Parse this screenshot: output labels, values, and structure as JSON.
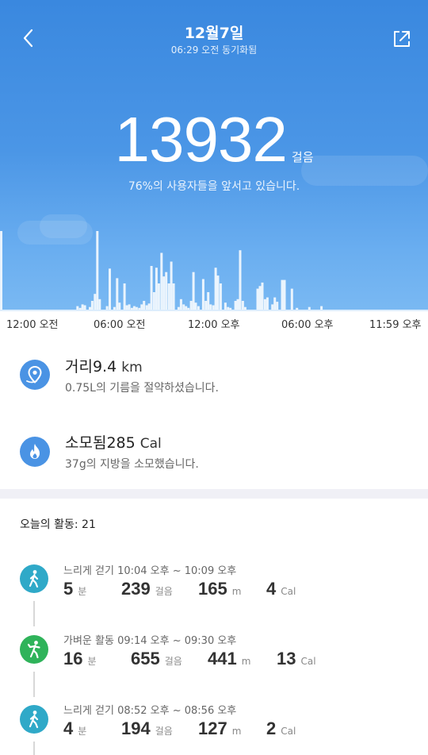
{
  "header": {
    "date": "12월7일",
    "sync_status": "06:29 오전 동기화됨",
    "back_icon": "chevron-left-icon",
    "share_icon": "share-icon"
  },
  "steps": {
    "count": "13932",
    "unit": "걸음",
    "percentile_text": "76%의 사용자들을 앞서고 있습니다."
  },
  "chart_data": {
    "type": "bar",
    "title": "",
    "x_tick_labels": [
      "12:00 오전",
      "06:00 오전",
      "12:00 오후",
      "06:00 오후",
      "11:59 오후"
    ],
    "x_range_minutes": [
      0,
      1439
    ],
    "y_max": 1,
    "bars": [
      {
        "t": 0,
        "v": 0.9
      },
      {
        "t": 258,
        "v": 0.04
      },
      {
        "t": 267,
        "v": 0.02
      },
      {
        "t": 275,
        "v": 0.06
      },
      {
        "t": 283,
        "v": 0.05
      },
      {
        "t": 300,
        "v": 0.03
      },
      {
        "t": 308,
        "v": 0.1
      },
      {
        "t": 317,
        "v": 0.18
      },
      {
        "t": 325,
        "v": 0.9
      },
      {
        "t": 333,
        "v": 0.12
      },
      {
        "t": 358,
        "v": 0.04
      },
      {
        "t": 367,
        "v": 0.47
      },
      {
        "t": 383,
        "v": 0.03
      },
      {
        "t": 392,
        "v": 0.36
      },
      {
        "t": 400,
        "v": 0.08
      },
      {
        "t": 417,
        "v": 0.3
      },
      {
        "t": 425,
        "v": 0.05
      },
      {
        "t": 433,
        "v": 0.06
      },
      {
        "t": 442,
        "v": 0.02
      },
      {
        "t": 450,
        "v": 0.04
      },
      {
        "t": 458,
        "v": 0.03
      },
      {
        "t": 467,
        "v": 0.02
      },
      {
        "t": 475,
        "v": 0.06
      },
      {
        "t": 483,
        "v": 0.1
      },
      {
        "t": 492,
        "v": 0.05
      },
      {
        "t": 500,
        "v": 0.07
      },
      {
        "t": 508,
        "v": 0.5
      },
      {
        "t": 517,
        "v": 0.2
      },
      {
        "t": 525,
        "v": 0.48
      },
      {
        "t": 533,
        "v": 0.3
      },
      {
        "t": 542,
        "v": 0.65
      },
      {
        "t": 550,
        "v": 0.38
      },
      {
        "t": 558,
        "v": 0.43
      },
      {
        "t": 567,
        "v": 0.3
      },
      {
        "t": 575,
        "v": 0.55
      },
      {
        "t": 583,
        "v": 0.3
      },
      {
        "t": 600,
        "v": 0.03
      },
      {
        "t": 608,
        "v": 0.12
      },
      {
        "t": 617,
        "v": 0.06
      },
      {
        "t": 625,
        "v": 0.04
      },
      {
        "t": 633,
        "v": 0.02
      },
      {
        "t": 642,
        "v": 0.1
      },
      {
        "t": 650,
        "v": 0.43
      },
      {
        "t": 658,
        "v": 0.08
      },
      {
        "t": 667,
        "v": 0.04
      },
      {
        "t": 683,
        "v": 0.35
      },
      {
        "t": 692,
        "v": 0.1
      },
      {
        "t": 700,
        "v": 0.2
      },
      {
        "t": 708,
        "v": 0.06
      },
      {
        "t": 717,
        "v": 0.05
      },
      {
        "t": 725,
        "v": 0.48
      },
      {
        "t": 733,
        "v": 0.39
      },
      {
        "t": 742,
        "v": 0.3
      },
      {
        "t": 758,
        "v": 0.08
      },
      {
        "t": 767,
        "v": 0.03
      },
      {
        "t": 775,
        "v": 0.02
      },
      {
        "t": 792,
        "v": 0.1
      },
      {
        "t": 800,
        "v": 0.12
      },
      {
        "t": 808,
        "v": 0.68
      },
      {
        "t": 817,
        "v": 0.1
      },
      {
        "t": 825,
        "v": 0.03
      },
      {
        "t": 867,
        "v": 0.24
      },
      {
        "t": 875,
        "v": 0.27
      },
      {
        "t": 883,
        "v": 0.31
      },
      {
        "t": 892,
        "v": 0.12
      },
      {
        "t": 900,
        "v": 0.14
      },
      {
        "t": 917,
        "v": 0.06
      },
      {
        "t": 925,
        "v": 0.14
      },
      {
        "t": 933,
        "v": 0.09
      },
      {
        "t": 950,
        "v": 0.34
      },
      {
        "t": 958,
        "v": 0.34
      },
      {
        "t": 983,
        "v": 0.24
      },
      {
        "t": 1000,
        "v": 0.02
      },
      {
        "t": 1042,
        "v": 0.03
      },
      {
        "t": 1083,
        "v": 0.04
      }
    ]
  },
  "metrics": [
    {
      "icon": "location-pin-icon",
      "label": "거리",
      "value": "9.4",
      "unit": "km",
      "subtitle": "0.75L의 기름을 절약하셨습니다."
    },
    {
      "icon": "flame-icon",
      "label": "소모됨",
      "value": "285",
      "unit": "Cal",
      "subtitle": "37g의 지방을 소모했습니다."
    }
  ],
  "summary": {
    "label": "오늘의 활동:",
    "count": "21"
  },
  "activities": [
    {
      "icon": "walking-icon",
      "color": "#2fa9c8",
      "type": "느리게 걷기",
      "time": "10:04 오후 ~ 10:09 오후",
      "duration": "5",
      "duration_unit": "분",
      "steps": "239",
      "steps_unit": "걸음",
      "distance": "165",
      "distance_unit": "m",
      "calories": "4",
      "calories_unit": "Cal"
    },
    {
      "icon": "light-activity-icon",
      "color": "#2fb35a",
      "type": "가벼운 활동",
      "time": "09:14 오후 ~ 09:30 오후",
      "duration": "16",
      "duration_unit": "분",
      "steps": "655",
      "steps_unit": "걸음",
      "distance": "441",
      "distance_unit": "m",
      "calories": "13",
      "calories_unit": "Cal"
    },
    {
      "icon": "walking-icon",
      "color": "#2fa9c8",
      "type": "느리게 걷기",
      "time": "08:52 오후 ~ 08:56 오후",
      "duration": "4",
      "duration_unit": "분",
      "steps": "194",
      "steps_unit": "걸음",
      "distance": "127",
      "distance_unit": "m",
      "calories": "2",
      "calories_unit": "Cal"
    }
  ]
}
